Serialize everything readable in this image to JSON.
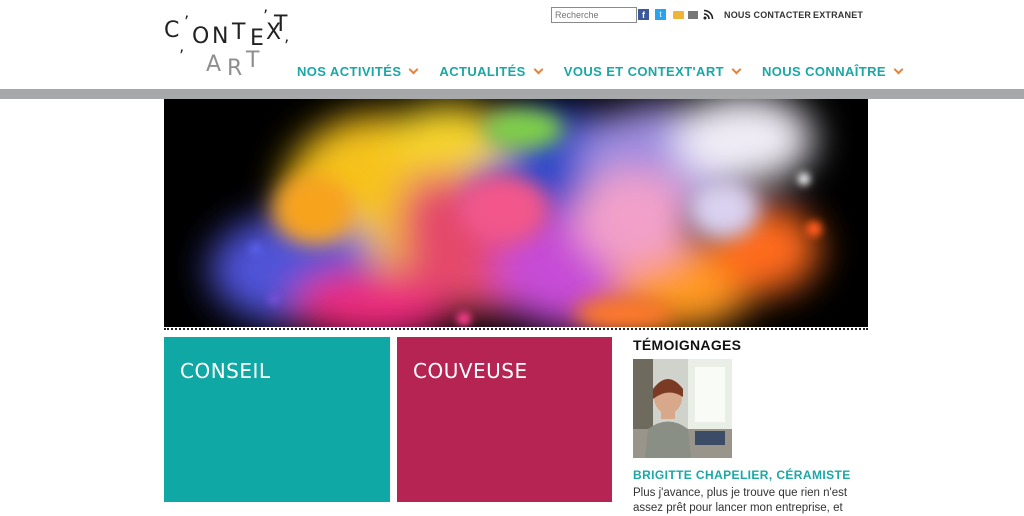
{
  "logo": {
    "letters": [
      "C",
      "O",
      "N",
      "T",
      "E",
      "X",
      "T",
      "A",
      "R",
      "T"
    ],
    "apostrophes": [
      "’",
      "’",
      "’"
    ]
  },
  "search": {
    "placeholder": "Recherche"
  },
  "social_icons": [
    "facebook-icon",
    "twitter-icon",
    "folder-icon",
    "print-icon",
    "rss-icon"
  ],
  "toplinks": {
    "contact": "NOUS CONTACTER",
    "extranet": "EXTRANET"
  },
  "nav": {
    "items": [
      {
        "label": "NOS ACTIVITÉS"
      },
      {
        "label": "ACTUALITÉS"
      },
      {
        "label": "VOUS ET CONTEXT'ART"
      },
      {
        "label": "NOUS CONNAÎTRE"
      }
    ]
  },
  "tiles": {
    "conseil": "CONSEIL",
    "couveuse": "COUVEUSE"
  },
  "testimonials": {
    "title": "TÉMOIGNAGES",
    "name": "BRIGITTE CHAPELIER, CÉRAMISTE",
    "quote": "Plus j'avance, plus je trouve que rien n'est assez prêt pour lancer mon entreprise, et"
  },
  "colors": {
    "teal": "#10a8a5",
    "raspberry": "#b62454",
    "accent_orange": "#e8823a",
    "band_gray": "#a7a8aa"
  }
}
